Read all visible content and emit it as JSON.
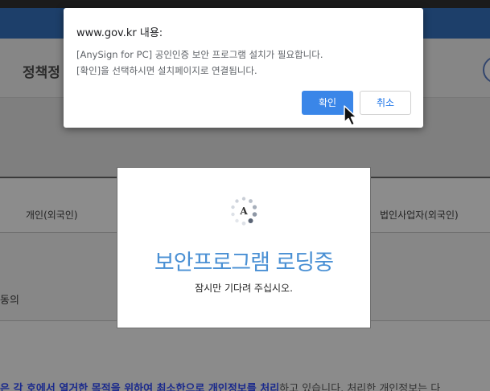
{
  "background_page": {
    "header_title": "정책정",
    "table_headers": {
      "left": "개인(외국인)",
      "right": "법인사업자(외국인)"
    },
    "row_text": "동의",
    "bottom_text": {
      "underlined": "은 각 호에서 열거한 목적을 위하여 최소한으로 개인정보를 처리",
      "rest": "하고 있습니다. 처리한 개인정보는 다"
    }
  },
  "loading_modal": {
    "spinner_letter": "A",
    "title": "보안프로그램 로딩중",
    "subtitle": "잠시만 기다려 주십시오."
  },
  "alert": {
    "title": "www.gov.kr 내용:",
    "message_line1": "[AnySign for PC] 공인인증 보안 프로그램 설치가 필요합니다.",
    "message_line2": "[확인]을 선택하시면 설치페이지로 연결됩니다.",
    "ok_label": "확인",
    "cancel_label": "취소"
  },
  "colors": {
    "ok_button": "#3a86e8",
    "loading_title": "#4a90d4",
    "topbar": "#1d3f6a"
  }
}
